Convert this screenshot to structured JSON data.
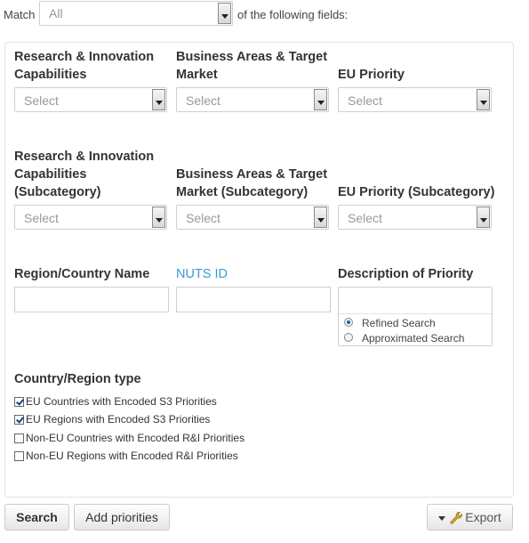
{
  "match": {
    "label": "Match",
    "value": "All",
    "suffix": "of the following fields:"
  },
  "row1": {
    "ri_label": "Research & Innovation Capabilities",
    "ri_value": "Select",
    "ba_label": "Business Areas & Target Market",
    "ba_value": "Select",
    "eu_label": "EU Priority",
    "eu_value": "Select"
  },
  "row2": {
    "ri_label": "Research & Innovation Capabilities (Subcategory)",
    "ri_value": "Select",
    "ba_label": "Business Areas & Target Market (Subcategory)",
    "ba_value": "Select",
    "eu_label": "EU Priority (Subcategory)",
    "eu_value": "Select"
  },
  "row3": {
    "region_label": "Region/Country Name",
    "region_value": "",
    "nuts_label": "NUTS ID",
    "nuts_value": "",
    "desc_label": "Description of Priority",
    "desc_value": "",
    "radio_refined": "Refined Search",
    "radio_approx": "Approximated Search",
    "radio_selected": "Refined Search"
  },
  "country_type": {
    "label": "Country/Region type",
    "options": [
      {
        "label": "EU Countries with Encoded S3 Priorities",
        "checked": true
      },
      {
        "label": "EU Regions with Encoded S3 Priorities",
        "checked": true
      },
      {
        "label": "Non-EU Countries with Encoded R&I Priorities",
        "checked": false
      },
      {
        "label": "Non-EU Regions with Encoded R&I Priorities",
        "checked": false
      }
    ]
  },
  "actions": {
    "search": "Search",
    "add": "Add priorities",
    "export": "Export"
  }
}
